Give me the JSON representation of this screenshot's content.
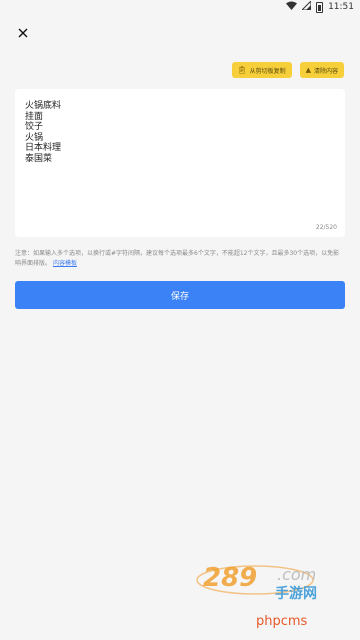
{
  "status_bar": {
    "time": "11:51"
  },
  "toolbar": {
    "paste_label": "从剪切板复制",
    "clear_label": "清除内容"
  },
  "editor": {
    "lines": [
      "火锅底料",
      "挂面",
      "饺子",
      "火锅",
      "日本料理",
      "泰国菜"
    ],
    "char_count": "22/520"
  },
  "note": {
    "text": "注意：如果输入多个选项，以换行或#字符间隔，建议每个选项最多6个文字，不能超12个文字，且最多30个选项，以免影响界面排版。",
    "link": "内容模板"
  },
  "save_label": "保存",
  "watermark": {
    "site": "phpcms",
    "logo_text": "289.com",
    "logo_sub": "手游网"
  },
  "colors": {
    "accent": "#3b82f6",
    "pill": "#f6cf3b",
    "background": "#f5f5f5"
  }
}
